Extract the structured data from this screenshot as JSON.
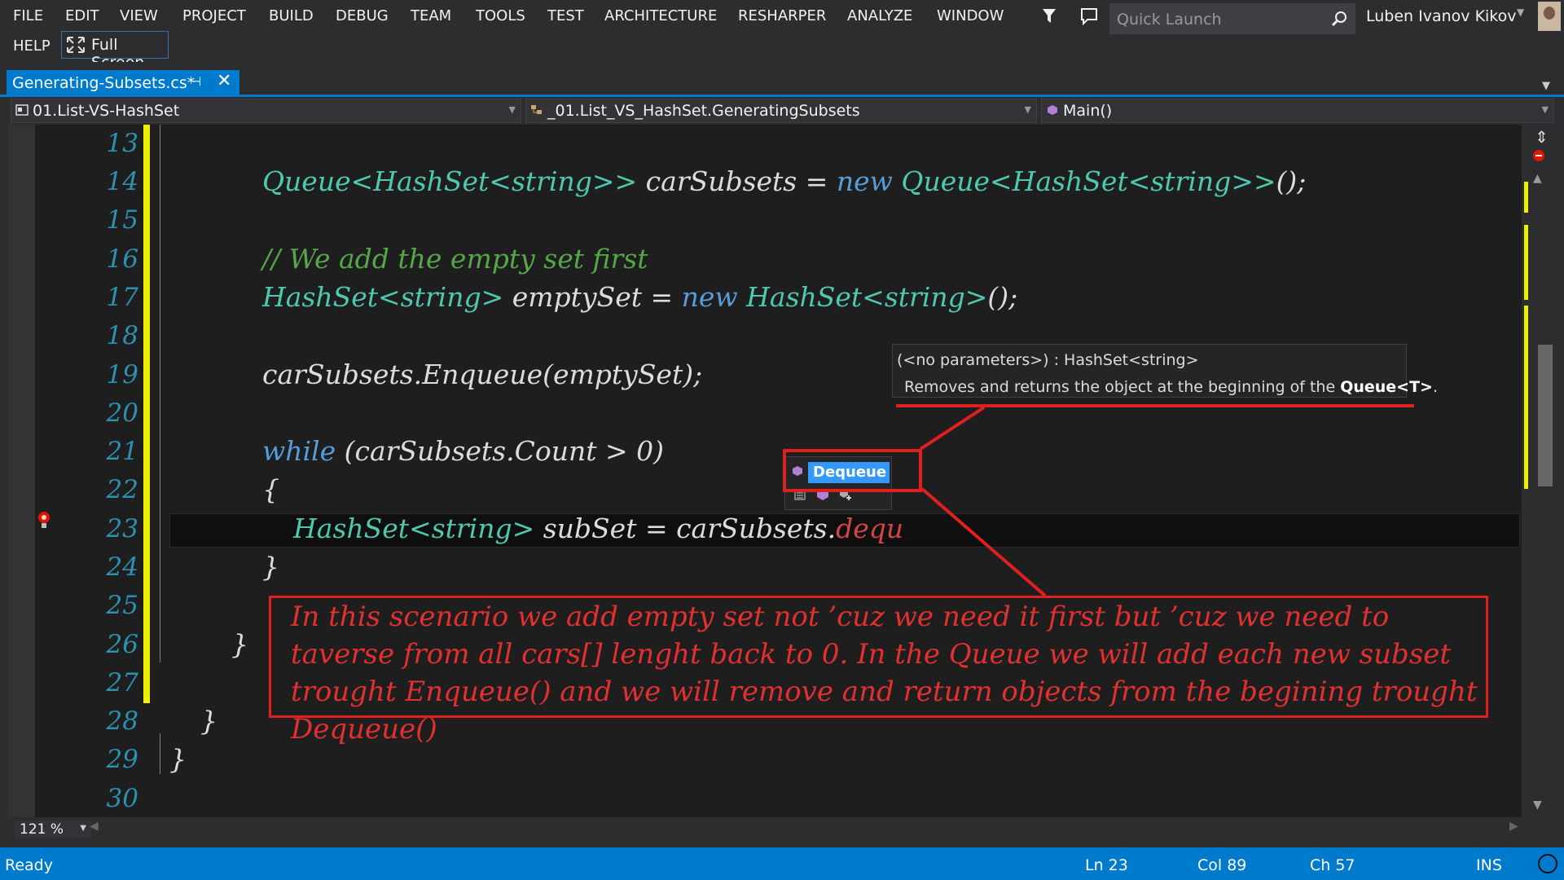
{
  "menu": [
    "FILE",
    "EDIT",
    "VIEW",
    "PROJECT",
    "BUILD",
    "DEBUG",
    "TEAM",
    "TOOLS",
    "TEST",
    "ARCHITECTURE",
    "RESHARPER",
    "ANALYZE",
    "WINDOW",
    "HELP"
  ],
  "full_screen_label": "Full Screen",
  "quick_launch_placeholder": "Quick Launch",
  "user_name": "Luben Ivanov Kikov",
  "tab": {
    "title": "Generating-Subsets.cs*",
    "pin": "⊣",
    "close": "✕"
  },
  "nav": {
    "project": "01.List-VS-HashSet",
    "class": "_01.List_VS_HashSet.GeneratingSubsets",
    "member": "Main()"
  },
  "line_numbers": [
    "13",
    "14",
    "15",
    "16",
    "17",
    "18",
    "19",
    "20",
    "21",
    "22",
    "23",
    "24",
    "25",
    "26",
    "27",
    "28",
    "29",
    "30"
  ],
  "code": {
    "l14_type": "Queue<HashSet<string>>",
    "l14_name": " carSubsets = ",
    "l14_new": "new",
    "l14_type2": " Queue<HashSet<string>>",
    "l14_end": "();",
    "l16_comment": "// We add the empty set first",
    "l17_type": "HashSet<string>",
    "l17_name": " emptySet = ",
    "l17_new": "new",
    "l17_type2": " HashSet<string>",
    "l17_end": "();",
    "l19": "carSubsets.Enqueue(emptySet);",
    "l21_kw": "while",
    "l21_rest": " (carSubsets.Count > 0)",
    "l22": "{",
    "l23_type": "HashSet<string>",
    "l23_rest": " subSet = carSubsets.",
    "l23_err": "dequ",
    "l24": "}",
    "l26": "}",
    "l28": "}",
    "l29": "}"
  },
  "tooltip": {
    "signature": "(<no parameters>) : HashSet<string>",
    "desc_pre": "Removes and returns the object at the beginning of the ",
    "desc_bold": "Queue<T>",
    "desc_post": "."
  },
  "intellisense_item": "Dequeue",
  "annotation": "In this scenario we add empty set not ’cuz we need it first but ’cuz we need to taverse from all cars[] lenght back to 0. In the Queue we will add each new subset trought Enqueue() and we will remove and return objects from the begining trought Dequeue()",
  "zoom": "121 %",
  "status": {
    "ready": "Ready",
    "ln": "Ln 23",
    "col": "Col 89",
    "ch": "Ch 57",
    "mode": "INS"
  }
}
